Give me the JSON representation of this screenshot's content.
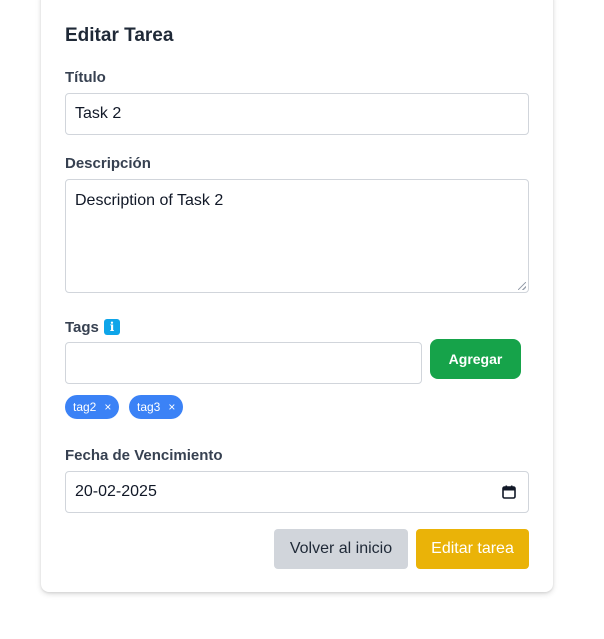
{
  "form": {
    "heading": "Editar Tarea",
    "title_label": "Título",
    "title_value": "Task 2",
    "description_label": "Descripción",
    "description_value": "Description of Task 2",
    "tags_label": "Tags",
    "tags_info_icon": "i",
    "tag_input_value": "",
    "add_button": "Agregar",
    "tags": [
      {
        "label": "tag2",
        "remove": "×"
      },
      {
        "label": "tag3",
        "remove": "×"
      }
    ],
    "due_label": "Fecha de Vencimiento",
    "due_value": "20-02-2025",
    "back_button": "Volver al inicio",
    "submit_button": "Editar tarea"
  },
  "colors": {
    "add_button": "#16a34a",
    "tag_chip": "#3b82f6",
    "submit_button": "#eab308",
    "back_button": "#d1d5db",
    "info_icon": "#0ea5e9"
  }
}
